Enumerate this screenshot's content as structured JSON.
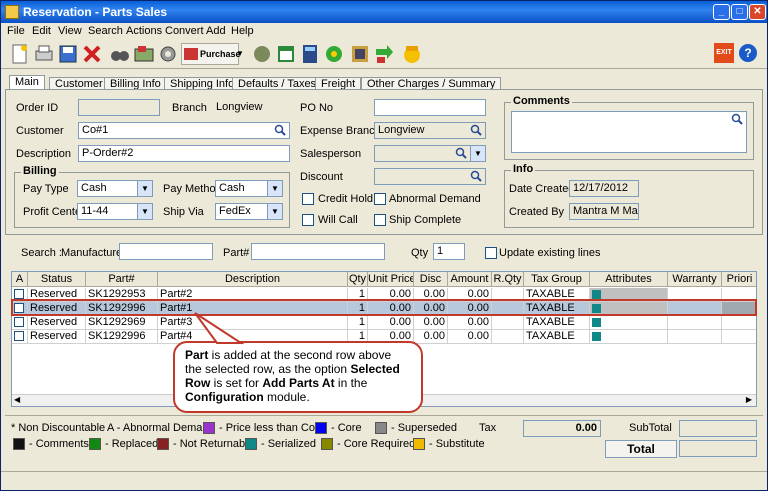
{
  "window": {
    "title": "Reservation - Parts Sales",
    "min": "_",
    "max": "□",
    "close": "✕"
  },
  "menu": [
    "File",
    "Edit",
    "View",
    "Search",
    "Actions",
    "Convert",
    "Add",
    "Help"
  ],
  "toolbar": {
    "purchase_label": "Purchase",
    "exit_label": "EXIT"
  },
  "tabs": [
    "Main",
    "Customer",
    "Billing Info",
    "Shipping Info",
    "Defaults / Taxes",
    "Freight",
    "Other Charges / Summary"
  ],
  "form": {
    "order_id_label": "Order ID",
    "order_id": "",
    "branch_label": "Branch",
    "branch": "Longview",
    "customer_label": "Customer",
    "customer": "Co#1",
    "description_label": "Description",
    "description": "P-Order#2",
    "po_no_label": "PO No",
    "po_no": "",
    "expense_branch_label": "Expense Branch",
    "expense_branch": "Longview",
    "salesperson_label": "Salesperson",
    "salesperson": "",
    "discount_label": "Discount",
    "discount": "",
    "credit_hold": "Credit Hold",
    "abnormal_demand": "Abnormal Demand",
    "will_call": "Will Call",
    "ship_complete": "Ship Complete",
    "comments_label": "Comments",
    "billing_label": "Billing",
    "pay_type_label": "Pay Type",
    "pay_type": "Cash",
    "pay_method_label": "Pay Method",
    "pay_method": "Cash",
    "profit_center_label": "Profit Center",
    "profit_center": "11-44",
    "ship_via_label": "Ship Via",
    "ship_via": "FedEx",
    "info_label": "Info",
    "date_created_label": "Date Created",
    "date_created": "12/17/2012",
    "created_by_label": "Created By",
    "created_by": "Mantra M Mantra"
  },
  "search": {
    "label": "Search :",
    "manufacturer_label": "Manufacturer",
    "part_label": "Part#",
    "qty_label": "Qty",
    "qty": "1",
    "update_label": "Update existing lines"
  },
  "grid": {
    "columns": [
      "A",
      "Status",
      "Part#",
      "Description",
      "Qty",
      "Unit Price",
      "Disc",
      "Amount",
      "R.Qty",
      "Tax Group",
      "Attributes",
      "Warranty",
      "Priori"
    ],
    "rows": [
      {
        "status": "Reserved",
        "part": "SK1292953",
        "desc": "Part#2",
        "qty": "1",
        "price": "0.00",
        "disc": "0.00",
        "amount": "0.00",
        "tax": "TAXABLE"
      },
      {
        "status": "Reserved",
        "part": "SK1292996",
        "desc": "Part#1",
        "qty": "1",
        "price": "0.00",
        "disc": "0.00",
        "amount": "0.00",
        "tax": "TAXABLE"
      },
      {
        "status": "Reserved",
        "part": "SK1292969",
        "desc": "Part#3",
        "qty": "1",
        "price": "0.00",
        "disc": "0.00",
        "amount": "0.00",
        "tax": "TAXABLE"
      },
      {
        "status": "Reserved",
        "part": "SK1292996",
        "desc": "Part#4",
        "qty": "1",
        "price": "0.00",
        "disc": "0.00",
        "amount": "0.00",
        "tax": "TAXABLE"
      }
    ]
  },
  "legend": {
    "non_discountable": "* Non Discountable",
    "abnormal": "A - Abnormal Demand",
    "price_less": "- Price less than Cost",
    "core": "- Core",
    "superseded": "- Superseded",
    "comments": "- Comments",
    "replaced": "- Replaced",
    "not_returnable": "- Not Returnable",
    "serialized": "- Serialized",
    "core_required": "- Core Required",
    "substitute": "- Substitute",
    "tax_label": "Tax",
    "tax_value": "0.00",
    "subtotal_label": "SubTotal",
    "total_label": "Total"
  },
  "colors": {
    "price_less": "#9933cc",
    "core": "#0000ee",
    "superseded": "#888888",
    "comments": "#111111",
    "replaced": "#118811",
    "not_returnable": "#882222",
    "serialized": "#118888",
    "core_required": "#888800",
    "substitute": "#eebb00"
  },
  "callout": {
    "t1": "Part",
    "t2": " is added at the second row above the selected row, as the option ",
    "t3": "Selected Row",
    "t4": " is set for ",
    "t5": "Add Parts At",
    "t6": " in the ",
    "t7": "Configuration",
    "t8": " module."
  }
}
